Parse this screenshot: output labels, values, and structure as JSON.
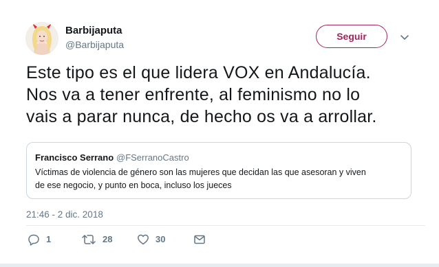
{
  "author": {
    "name": "Barbijaputa",
    "handle": "@Barbijaputa",
    "avatar_icon": "avatar-blonde-horns"
  },
  "follow_button": {
    "label": "Seguir"
  },
  "menu": {
    "icon": "chevron-down-icon"
  },
  "tweet": {
    "lines": [
      "Este tipo es el que lidera VOX en Andalucía.",
      "Nos va a tener enfrente, al feminismo no lo",
      "vais a parar nunca, de hecho os va a arrollar."
    ]
  },
  "quoted": {
    "name": "Francisco Serrano",
    "handle": "@FSerranoCastro",
    "lines": [
      "Víctimas de violencia de género son las mujeres que decidan las que asesoran y viven",
      "de ese negocio, y punto en boca, incluso los jueces"
    ]
  },
  "timestamp": "21:46 - 2 dic. 2018",
  "actions": {
    "reply_count": "1",
    "retweet_count": "28",
    "like_count": "30"
  },
  "colors": {
    "accent": "#a2225e",
    "secondary_text": "#657786",
    "border": "#ccd6dd"
  }
}
